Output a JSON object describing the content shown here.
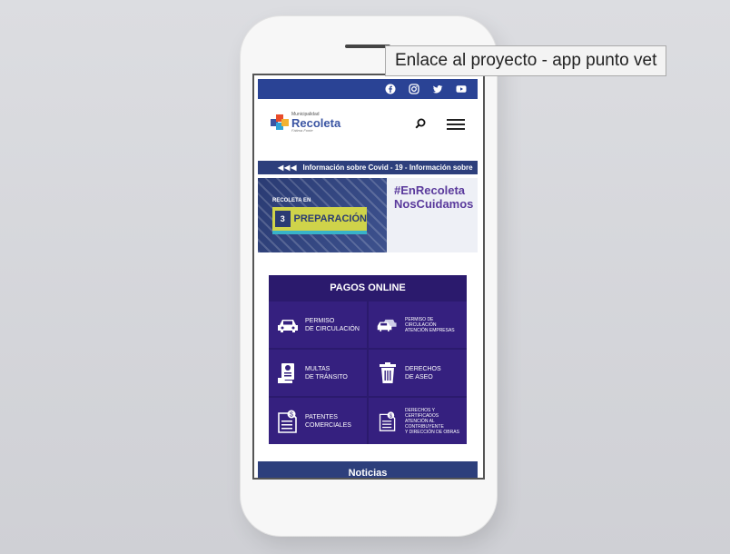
{
  "tooltip": {
    "text": "Enlace al proyecto - app punto vet"
  },
  "colors": {
    "primary": "#2a4395",
    "purple": "#2b1a6d",
    "ticker": "#2d3f7c"
  },
  "header": {
    "logo_small": "Municipalidad",
    "logo_name": "Recoleta",
    "logo_sig": "Fátima Fonte"
  },
  "social": [
    "facebook-icon",
    "instagram-icon",
    "twitter-icon",
    "youtube-icon"
  ],
  "ticker": {
    "arrows": "◀◀◀",
    "text": "Información sobre Covid - 19 - Información sobre"
  },
  "banner": {
    "recoleta_en": "RECOLETA EN",
    "step_num": "3",
    "step_word": "PREPARACIÓN",
    "hashtag": "#EnRecoleta\nNosCuidamos"
  },
  "pagos": {
    "title": "PAGOS ONLINE",
    "tiles": [
      {
        "label": "PERMISO\nDE CIRCULACIÓN",
        "icon": "car-icon"
      },
      {
        "label": "PERMISO DE\nCIRCULACIÓN\nATENCIÓN EMPRESAS",
        "icon": "cars-icon"
      },
      {
        "label": "MULTAS\nDE TRÁNSITO",
        "icon": "ticket-icon"
      },
      {
        "label": "DERECHOS\nDE ASEO",
        "icon": "trash-icon"
      },
      {
        "label": "PATENTES\nCOMERCIALES",
        "icon": "document-money-icon"
      },
      {
        "label": "DERECHOS Y CERTIFICADOS\nATENCIÓN AL CONTRIBUYENTE\nY DIRECCIÓN DE OBRAS",
        "icon": "document-money-icon"
      }
    ]
  },
  "noticias": {
    "label": "Noticias"
  }
}
